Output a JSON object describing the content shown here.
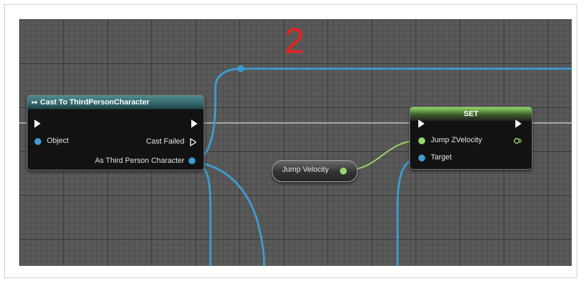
{
  "step_number": "2",
  "cast_node": {
    "title": "Cast To ThirdPersonCharacter",
    "object_label": "Object",
    "cast_failed_label": "Cast Failed",
    "as_label": "As Third Person Character"
  },
  "variable_node": {
    "label": "Jump Velocity"
  },
  "set_node": {
    "title": "SET",
    "jump_label": "Jump ZVelocity",
    "target_label": "Target"
  },
  "colors": {
    "object_wire": "#3d9ccf",
    "float_wire": "#9bd66a",
    "exec_wire": "#c8c8c8",
    "step_number": "#e8231f"
  },
  "icons": [
    "exec-pin-icon",
    "object-pin-icon",
    "float-pin-icon",
    "reroute-knot-icon"
  ]
}
